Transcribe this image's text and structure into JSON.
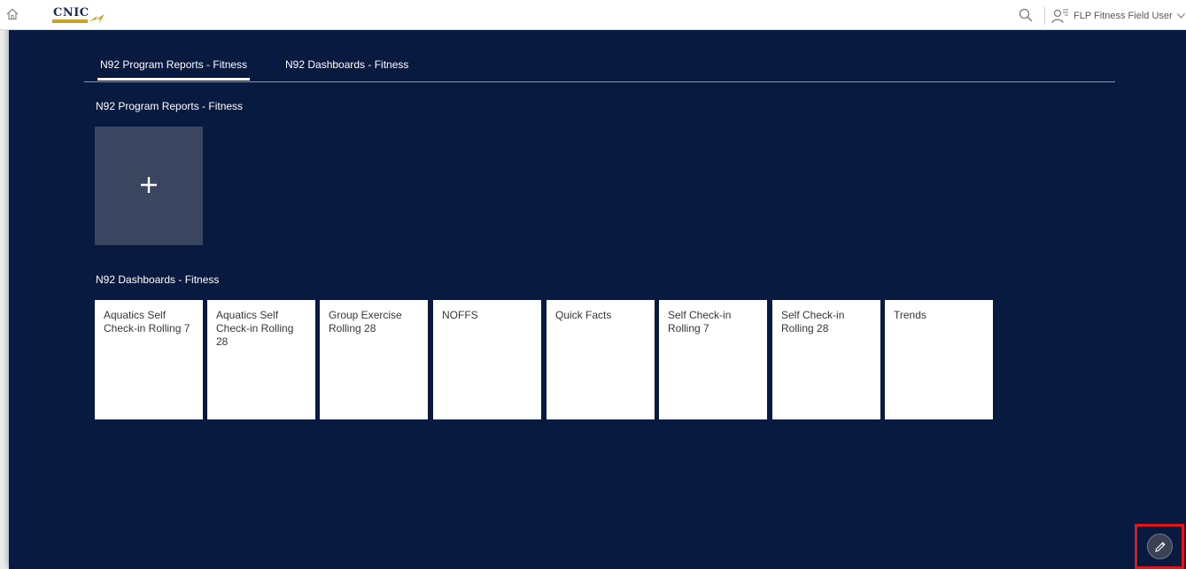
{
  "shell": {
    "logo_text": "CNIC",
    "user_name": "FLP Fitness Field User"
  },
  "tabs": [
    {
      "label": "N92 Program Reports - Fitness",
      "active": true
    },
    {
      "label": "N92 Dashboards - Fitness",
      "active": false
    }
  ],
  "sections": {
    "reports": {
      "title": "N92 Program Reports - Fitness"
    },
    "dashboards": {
      "title": "N92 Dashboards - Fitness",
      "tiles": [
        {
          "title": "Aquatics Self Check-in Rolling 7"
        },
        {
          "title": "Aquatics Self Check-in Rolling 28"
        },
        {
          "title": "Group Exercise Rolling 28"
        },
        {
          "title": "NOFFS"
        },
        {
          "title": "Quick Facts"
        },
        {
          "title": "Self Check-in Rolling 7"
        },
        {
          "title": "Self Check-in Rolling 28"
        },
        {
          "title": "Trends"
        }
      ]
    }
  },
  "icons": {
    "home": "home-icon",
    "search": "search-icon",
    "user": "user-icon",
    "chevron": "chevron-down-icon",
    "add": "plus-icon",
    "edit": "pencil-icon"
  },
  "colors": {
    "background": "#091a40",
    "tile": "#ffffff",
    "add_tile": "#3a4660",
    "highlight": "#e4141b"
  }
}
